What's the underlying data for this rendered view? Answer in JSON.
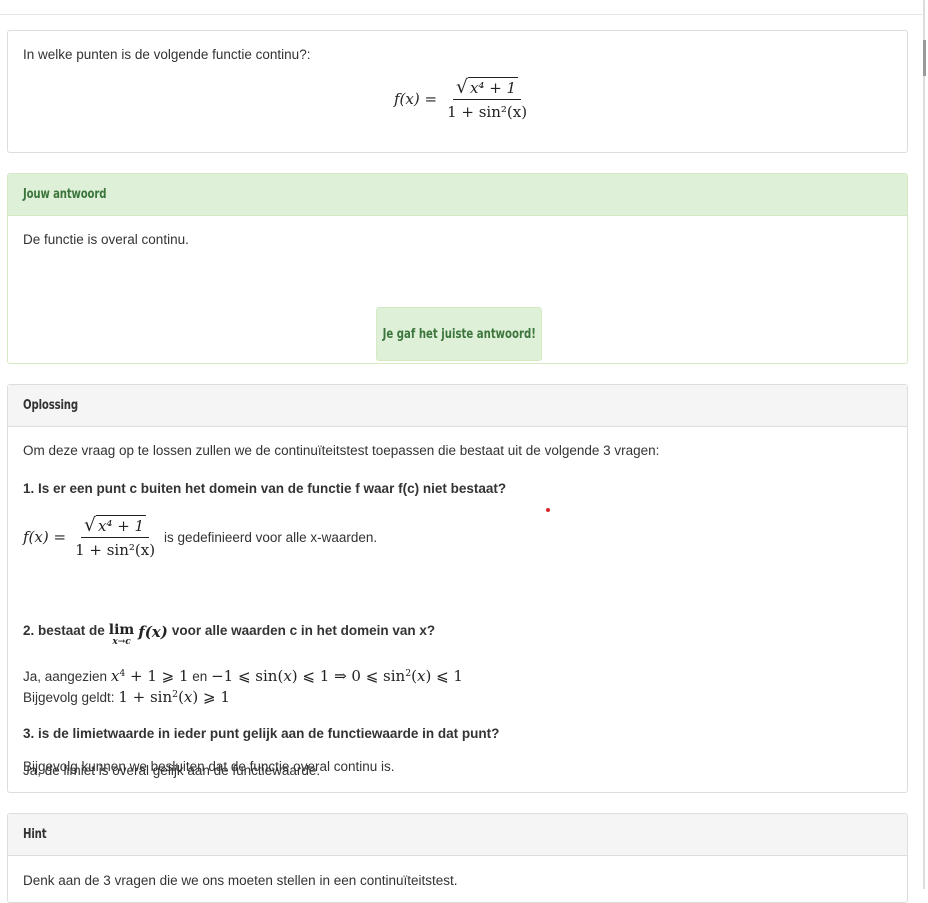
{
  "question": {
    "text": "In welke punten is de volgende functie continu?:",
    "formula_lhs": "f(x) =",
    "formula_num": "x⁴ + 1",
    "formula_den": "1 + sin²(x)"
  },
  "answer_panel": {
    "heading": "Jouw antwoord",
    "answer_text": "De functie is overal continu.",
    "feedback": "Je gaf het juiste antwoord!"
  },
  "solution_panel": {
    "heading": "Oplossing",
    "intro": "Om deze vraag op te lossen zullen we de continuïteitstest toepassen die bestaat uit de volgende 3 vragen:",
    "q1": "1. Is er een punt c buiten het domein van de functie f waar f(c) niet bestaat?",
    "q1_answer_suffix": "is gedefinieerd voor alle x-waarden.",
    "q2_prefix": "2. bestaat de",
    "q2_suffix": "voor alle waarden c in het domein van x?",
    "a2_line1_prefix": "Ja, aangezien",
    "a2_line1_en": "en",
    "a2_line2_prefix": "Bijgevolg geldt:",
    "q3": "3. is de limietwaarde in ieder punt gelijk aan de functiewaarde in dat punt?",
    "a3": "Ja, de limiet is overal gelijk aan de functiewaarde.",
    "conclusion": "Bijgevolg kunnen we besluiten dat de functie overal continu is."
  },
  "hint_panel": {
    "heading": "Hint",
    "text": "Denk aan de 3 vragen die we ons moeten stellen in een continuïteitstest."
  },
  "colors": {
    "success_bg": "#dff0d8",
    "success_text": "#3c763d",
    "panel_head_bg": "#f5f5f5",
    "border": "#dddddd"
  }
}
